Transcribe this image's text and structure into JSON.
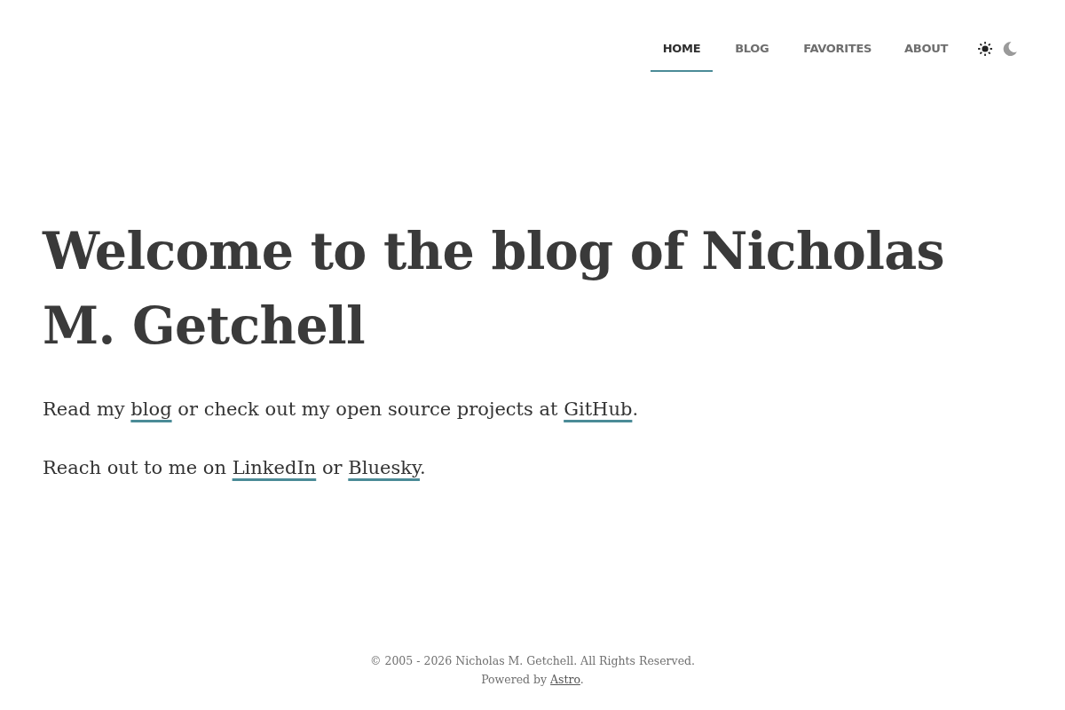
{
  "nav": {
    "items": [
      {
        "label": "HOME",
        "selected": true
      },
      {
        "label": "BLOG",
        "selected": false
      },
      {
        "label": "FAVORITES",
        "selected": false
      },
      {
        "label": "ABOUT",
        "selected": false
      }
    ],
    "theme_toggle": [
      {
        "kind": "sun",
        "selected": true
      },
      {
        "kind": "moon",
        "selected": false
      }
    ]
  },
  "hero": {
    "title": "Welcome to the blog of Nicholas M. Getchell",
    "paragraphs": [
      {
        "parts": [
          {
            "kind": "text",
            "text": "Read my "
          },
          {
            "kind": "link",
            "text": "blog"
          },
          {
            "kind": "text",
            "text": " or check out my open source projects at "
          },
          {
            "kind": "link",
            "text": "GitHub"
          },
          {
            "kind": "text",
            "text": "."
          }
        ]
      },
      {
        "parts": [
          {
            "kind": "text",
            "text": "Reach out to me on "
          },
          {
            "kind": "link",
            "text": "LinkedIn"
          },
          {
            "kind": "text",
            "text": " or "
          },
          {
            "kind": "link",
            "text": "Bluesky"
          },
          {
            "kind": "text",
            "text": "."
          }
        ]
      }
    ]
  },
  "footer": {
    "copyright": "© 2005 - 2026 Nicholas M. Getchell. All Rights Reserved.",
    "powered": [
      {
        "kind": "text",
        "text": "Powered by "
      },
      {
        "kind": "link",
        "text": "Astro"
      },
      {
        "kind": "text",
        "text": "."
      }
    ]
  }
}
